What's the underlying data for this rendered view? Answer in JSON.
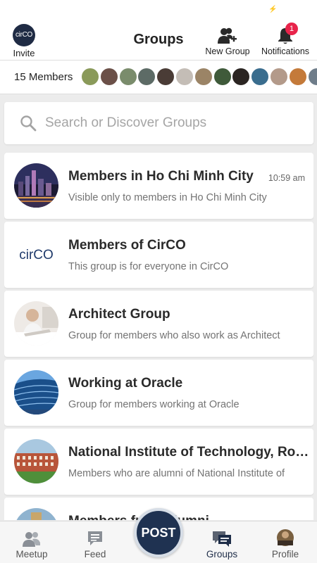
{
  "status_bar": {
    "glyph": "⚡"
  },
  "header": {
    "title": "Groups",
    "invite": {
      "logo_text": "cirCO",
      "label": "Invite"
    },
    "new_group": {
      "label": "New Group",
      "icon": "add-group-icon"
    },
    "notifications": {
      "label": "Notifications",
      "badge": "1",
      "icon": "bell-icon",
      "badge_color": "#e8234a"
    }
  },
  "members_bar": {
    "count_label": "15 Members",
    "avatar_colors": [
      "#8a9a5a",
      "#6b5048",
      "#7a8c6c",
      "#5d6b66",
      "#4a3c36",
      "#c4bdb6",
      "#9b8466",
      "#3f5a3a",
      "#2b2522",
      "#3a6d8e",
      "#b39a8a",
      "#c47a3a",
      "#6f7d8a"
    ]
  },
  "search": {
    "placeholder": "Search or Discover Groups",
    "icon": "search-icon"
  },
  "groups": [
    {
      "title": "Members in Ho Chi Minh City",
      "description": "Visible only to members in Ho Chi Minh City",
      "time": "10:59 am"
    },
    {
      "title": "Members of CirCO",
      "description": "This group is for everyone in CirCO",
      "logo_text": "cirCO"
    },
    {
      "title": "Architect Group",
      "description": "Group for members who also work as Architect"
    },
    {
      "title": "Working at Oracle",
      "description": "Group for members working at Oracle"
    },
    {
      "title": "National Institute of Technology, Rourkela",
      "description": "Members who are alumni of National Institute of"
    },
    {
      "title": "Members from Alumni",
      "description": ""
    }
  ],
  "bottom_nav": {
    "items": [
      {
        "label": "Meetup",
        "icon": "people-icon"
      },
      {
        "label": "Feed",
        "icon": "feed-icon"
      },
      {
        "label": "Groups",
        "icon": "groups-chat-icon",
        "active": true
      },
      {
        "label": "Profile",
        "icon": "profile-avatar-icon"
      }
    ],
    "post_label": "POST",
    "accent": "#1f3251"
  }
}
